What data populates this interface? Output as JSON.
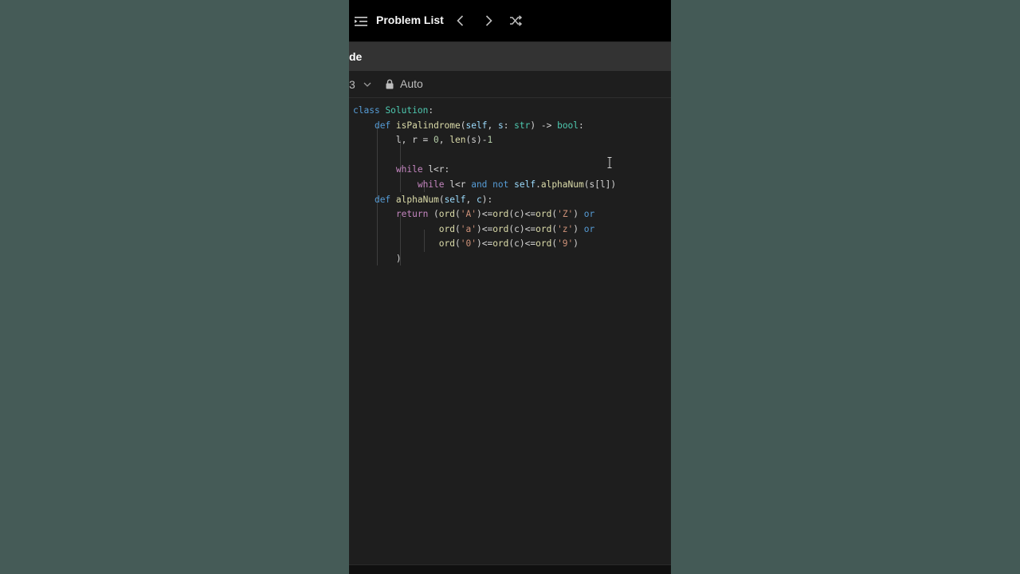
{
  "header": {
    "title": "Problem List",
    "list_icon": "list-indent-icon",
    "prev_icon": "chevron-left-icon",
    "next_icon": "chevron-right-icon",
    "shuffle_icon": "shuffle-icon"
  },
  "tab": {
    "label": "de"
  },
  "toolbar": {
    "language": "3",
    "mode": "Auto",
    "lock_icon": "lock-icon",
    "dropdown_icon": "chevron-down-icon"
  },
  "code": {
    "line1": [
      {
        "c": "kw2",
        "t": "class"
      },
      {
        "c": "",
        "t": " "
      },
      {
        "c": "cls",
        "t": "Solution"
      },
      {
        "c": "",
        "t": ":"
      }
    ],
    "line2": [
      {
        "c": "",
        "t": "    "
      },
      {
        "c": "kw2",
        "t": "def"
      },
      {
        "c": "",
        "t": " "
      },
      {
        "c": "fn",
        "t": "isPalindrome"
      },
      {
        "c": "",
        "t": "("
      },
      {
        "c": "var",
        "t": "self"
      },
      {
        "c": "",
        "t": ", "
      },
      {
        "c": "var",
        "t": "s"
      },
      {
        "c": "",
        "t": ": "
      },
      {
        "c": "cls",
        "t": "str"
      },
      {
        "c": "",
        "t": ") -> "
      },
      {
        "c": "cls",
        "t": "bool"
      },
      {
        "c": "",
        "t": ":"
      }
    ],
    "line3": [
      {
        "c": "",
        "t": "        l, r = "
      },
      {
        "c": "num",
        "t": "0"
      },
      {
        "c": "",
        "t": ", "
      },
      {
        "c": "fn",
        "t": "len"
      },
      {
        "c": "",
        "t": "(s)-"
      },
      {
        "c": "num",
        "t": "1"
      }
    ],
    "line4": [
      {
        "c": "",
        "t": ""
      }
    ],
    "line5": [
      {
        "c": "",
        "t": "        "
      },
      {
        "c": "kw",
        "t": "while"
      },
      {
        "c": "",
        "t": " l<r:"
      }
    ],
    "line6": [
      {
        "c": "",
        "t": "            "
      },
      {
        "c": "kw",
        "t": "while"
      },
      {
        "c": "",
        "t": " l<r "
      },
      {
        "c": "kw2",
        "t": "and"
      },
      {
        "c": "",
        "t": " "
      },
      {
        "c": "kw2",
        "t": "not"
      },
      {
        "c": "",
        "t": " "
      },
      {
        "c": "var",
        "t": "self"
      },
      {
        "c": "",
        "t": "."
      },
      {
        "c": "fn",
        "t": "alphaNum"
      },
      {
        "c": "",
        "t": "(s[l])"
      }
    ],
    "line7": [
      {
        "c": "",
        "t": "    "
      },
      {
        "c": "kw2",
        "t": "def"
      },
      {
        "c": "",
        "t": " "
      },
      {
        "c": "fn",
        "t": "alphaNum"
      },
      {
        "c": "",
        "t": "("
      },
      {
        "c": "var",
        "t": "self"
      },
      {
        "c": "",
        "t": ", "
      },
      {
        "c": "var",
        "t": "c"
      },
      {
        "c": "",
        "t": "):"
      }
    ],
    "line8": [
      {
        "c": "",
        "t": "        "
      },
      {
        "c": "kw",
        "t": "return"
      },
      {
        "c": "",
        "t": " ("
      },
      {
        "c": "fn",
        "t": "ord"
      },
      {
        "c": "",
        "t": "("
      },
      {
        "c": "str",
        "t": "'A'"
      },
      {
        "c": "",
        "t": ")<="
      },
      {
        "c": "fn",
        "t": "ord"
      },
      {
        "c": "",
        "t": "(c)<="
      },
      {
        "c": "fn",
        "t": "ord"
      },
      {
        "c": "",
        "t": "("
      },
      {
        "c": "str",
        "t": "'Z'"
      },
      {
        "c": "",
        "t": ") "
      },
      {
        "c": "kw2",
        "t": "or"
      }
    ],
    "line9": [
      {
        "c": "",
        "t": "                "
      },
      {
        "c": "fn",
        "t": "ord"
      },
      {
        "c": "",
        "t": "("
      },
      {
        "c": "str",
        "t": "'a'"
      },
      {
        "c": "",
        "t": ")<="
      },
      {
        "c": "fn",
        "t": "ord"
      },
      {
        "c": "",
        "t": "(c)<="
      },
      {
        "c": "fn",
        "t": "ord"
      },
      {
        "c": "",
        "t": "("
      },
      {
        "c": "str",
        "t": "'z'"
      },
      {
        "c": "",
        "t": ") "
      },
      {
        "c": "kw2",
        "t": "or"
      }
    ],
    "line10": [
      {
        "c": "",
        "t": "                "
      },
      {
        "c": "fn",
        "t": "ord"
      },
      {
        "c": "",
        "t": "("
      },
      {
        "c": "str",
        "t": "'0'"
      },
      {
        "c": "",
        "t": ")<="
      },
      {
        "c": "fn",
        "t": "ord"
      },
      {
        "c": "",
        "t": "(c)<="
      },
      {
        "c": "fn",
        "t": "ord"
      },
      {
        "c": "",
        "t": "("
      },
      {
        "c": "str",
        "t": "'9'"
      },
      {
        "c": "",
        "t": ")"
      }
    ],
    "line11": [
      {
        "c": "",
        "t": "        )"
      }
    ]
  },
  "colors": {
    "background": "#445a56",
    "editor_bg": "#1e1e1e",
    "keyword": "#c586c0",
    "keyword_blue": "#569cd6",
    "class": "#4ec9b0",
    "function": "#dcdcaa",
    "string": "#ce9178"
  }
}
